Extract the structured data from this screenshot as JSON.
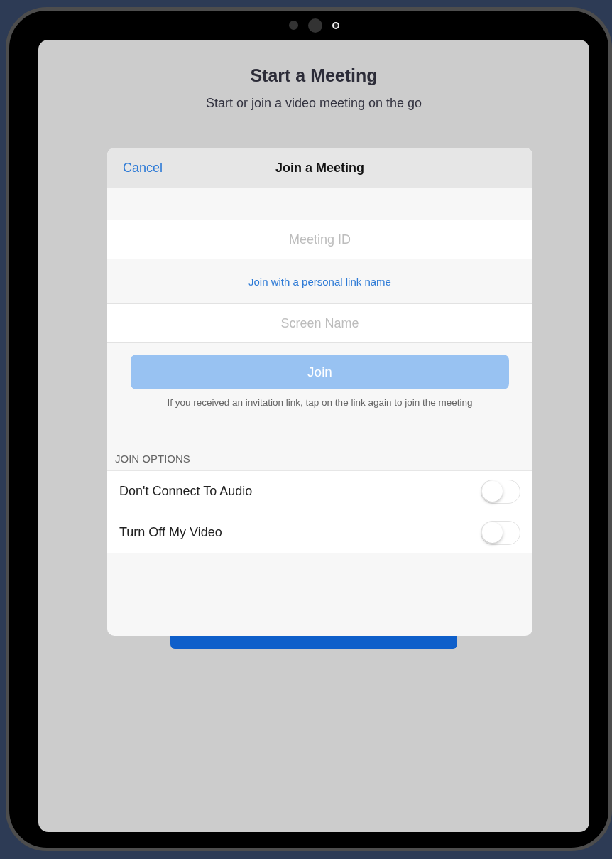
{
  "screen": {
    "title": "Start a Meeting",
    "subtitle": "Start or join a video meeting on the go"
  },
  "dialog": {
    "cancel": "Cancel",
    "title": "Join a Meeting",
    "fields": [
      {
        "kind": "input",
        "placeholder": "Meeting ID"
      },
      {
        "kind": "link",
        "label": "Join with a personal link name"
      },
      {
        "kind": "input",
        "placeholder": "Screen Name"
      }
    ],
    "join_button": {
      "label": "Join",
      "disabled": true
    },
    "hint": "If you received an invitation link, tap on the link again to join the meeting",
    "options_header": "JOIN OPTIONS",
    "options": [
      {
        "label": "Don't Connect To Audio",
        "on": false
      },
      {
        "label": "Turn Off My Video",
        "on": false
      }
    ]
  }
}
